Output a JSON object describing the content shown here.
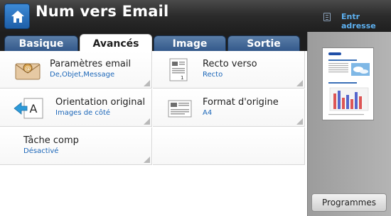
{
  "header": {
    "title": "Num vers Email",
    "address_link": "Entr adresse",
    "home_icon": "home-icon",
    "address_icon": "address-book-icon"
  },
  "tabs": [
    {
      "label": "Basique",
      "active": false
    },
    {
      "label": "Avancés",
      "active": true
    },
    {
      "label": "Image",
      "active": false
    },
    {
      "label": "Sortie",
      "active": false
    }
  ],
  "settings": [
    {
      "label": "Paramètres email",
      "value": "De,Objet,Message",
      "icon": "envelope-icon"
    },
    {
      "label": "Recto verso",
      "value": "Recto",
      "icon": "single-sided-page-icon"
    },
    {
      "label": "Orientation original",
      "value": "Images de côté",
      "icon": "orientation-arrow-icon"
    },
    {
      "label": "Format d'origine",
      "value": "A4",
      "icon": "original-size-page-icon"
    },
    {
      "label": "Tâche comp",
      "value": "Désactivé",
      "icon": ""
    }
  ],
  "side_panel": {
    "programs_button": "Programmes"
  },
  "colors": {
    "accent_blue": "#1b66b8",
    "tab_blue": "#2f5588",
    "link_blue": "#5db0f0"
  }
}
